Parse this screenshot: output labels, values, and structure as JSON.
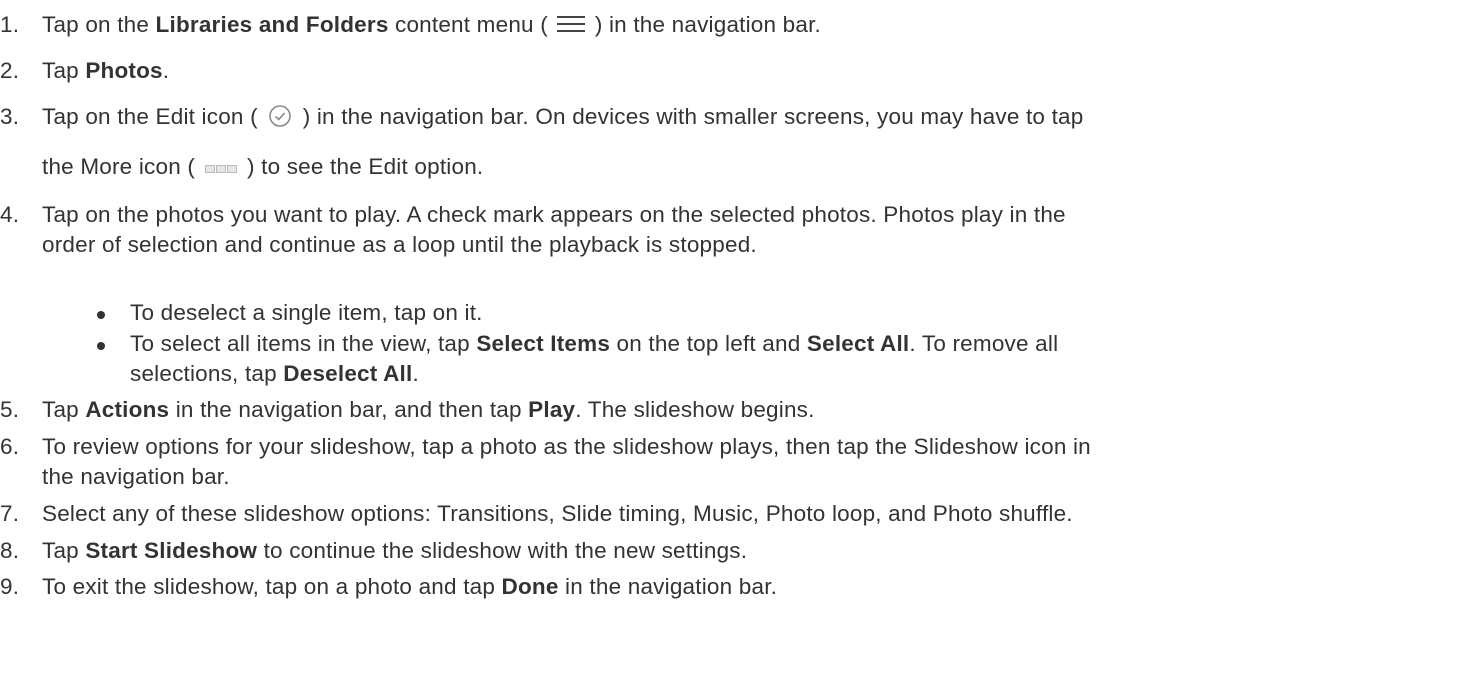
{
  "steps": {
    "s1": {
      "num": "1.",
      "a": "Tap on the ",
      "b1": "Libraries and Folders",
      "c": " content menu (",
      "d": ") in the navigation bar."
    },
    "s2": {
      "num": "2.",
      "a": "Tap ",
      "b1": "Photos",
      "c": "."
    },
    "s3": {
      "num": "3.",
      "a": "Tap on the Edit icon (",
      "b": ") in the navigation bar. On devices with smaller screens, you may have to tap",
      "line2a": "the More icon (",
      "line2b": ") to see the Edit option."
    },
    "s4": {
      "num": "4.",
      "line1": "Tap on the photos you want to play. A check mark appears on the selected photos. Photos play in the",
      "line2": "order of selection and continue as a loop until the playback is stopped."
    },
    "bullets": {
      "b1": {
        "text": "To deselect a single item, tap on it."
      },
      "b2": {
        "a": "To select all items in the view, tap ",
        "b1": "Select Items",
        "c": " on the top left and ",
        "d": "Select All",
        "e": ". To remove all",
        "line2a": "selections, tap ",
        "line2b": "Deselect All",
        "line2c": "."
      }
    },
    "s5": {
      "num": "5.",
      "a": "Tap ",
      "b1": "Actions",
      "c": " in the navigation bar, and then tap ",
      "d": "Play",
      "e": ". The slideshow begins."
    },
    "s6": {
      "num": "6.",
      "line1": "To review options for your slideshow, tap a photo as the slideshow plays, then tap the Slideshow icon in",
      "line2": "the navigation bar."
    },
    "s7": {
      "num": "7.",
      "text": "Select any of these slideshow options: Transitions, Slide timing, Music, Photo loop, and Photo shuffle."
    },
    "s8": {
      "num": "8.",
      "a": "Tap ",
      "b1": "Start Slideshow",
      "c": " to continue the slideshow with the new settings."
    },
    "s9": {
      "num": "9.",
      "a": "To exit the slideshow, tap on a photo and tap ",
      "b1": "Done",
      "c": " in the navigation bar."
    }
  },
  "icons": {
    "menu": "hamburger-menu-icon",
    "edit": "check-circle-icon",
    "more": "more-dots-icon"
  }
}
